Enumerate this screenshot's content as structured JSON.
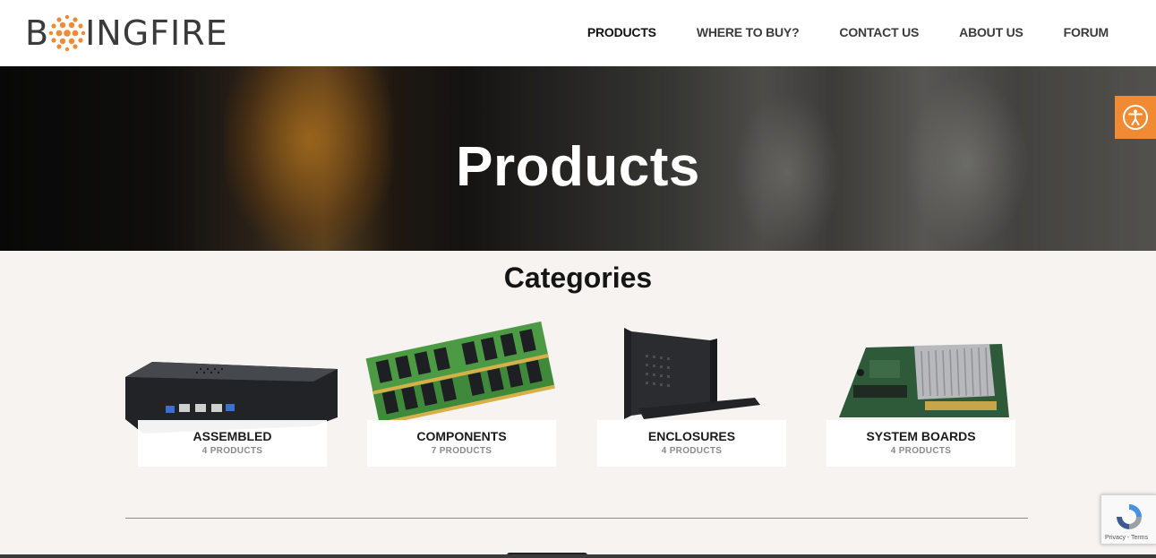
{
  "brand": {
    "logo_text_left": "B",
    "logo_text_right": "INGFIRE",
    "accent_color": "#f08a33"
  },
  "nav": {
    "items": [
      {
        "label": "PRODUCTS",
        "active": true
      },
      {
        "label": "WHERE TO BUY?",
        "active": false
      },
      {
        "label": "CONTACT US",
        "active": false
      },
      {
        "label": "ABOUT US",
        "active": false
      },
      {
        "label": "FORUM",
        "active": false
      }
    ]
  },
  "hero": {
    "title": "Products"
  },
  "accessibility": {
    "icon": "accessibility-icon"
  },
  "categories": {
    "title": "Categories",
    "items": [
      {
        "name": "ASSEMBLED",
        "count": "4 PRODUCTS",
        "icon": "mini-pc-image"
      },
      {
        "name": "COMPONENTS",
        "count": "7 PRODUCTS",
        "icon": "ram-modules-image"
      },
      {
        "name": "ENCLOSURES",
        "count": "4 PRODUCTS",
        "icon": "enclosure-image"
      },
      {
        "name": "SYSTEM BOARDS",
        "count": "4 PRODUCTS",
        "icon": "motherboard-image"
      }
    ]
  },
  "recaptcha": {
    "terms": "Privacy - Terms"
  }
}
